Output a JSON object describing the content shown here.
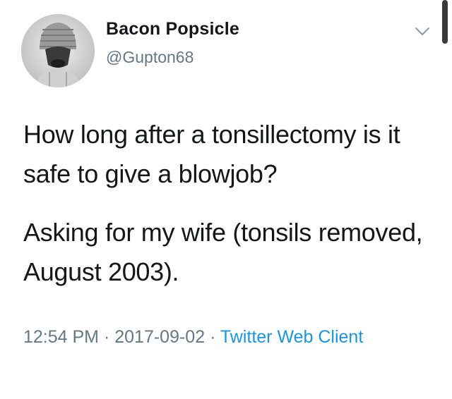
{
  "user": {
    "display_name": "Bacon Popsicle",
    "handle": "@Gupton68"
  },
  "tweet": {
    "paragraph_1": "How long after a tonsillectomy is it safe to give a blowjob?",
    "paragraph_2": "Asking for my wife (tonsils removed, August 2003)."
  },
  "meta": {
    "time": "12:54 PM",
    "separator": " · ",
    "date": "2017-09-02",
    "source": "Twitter Web Client"
  },
  "icons": {
    "menu": "chevron-down-icon"
  },
  "colors": {
    "text": "#14171a",
    "secondary": "#657786",
    "link": "#1b95e0"
  }
}
